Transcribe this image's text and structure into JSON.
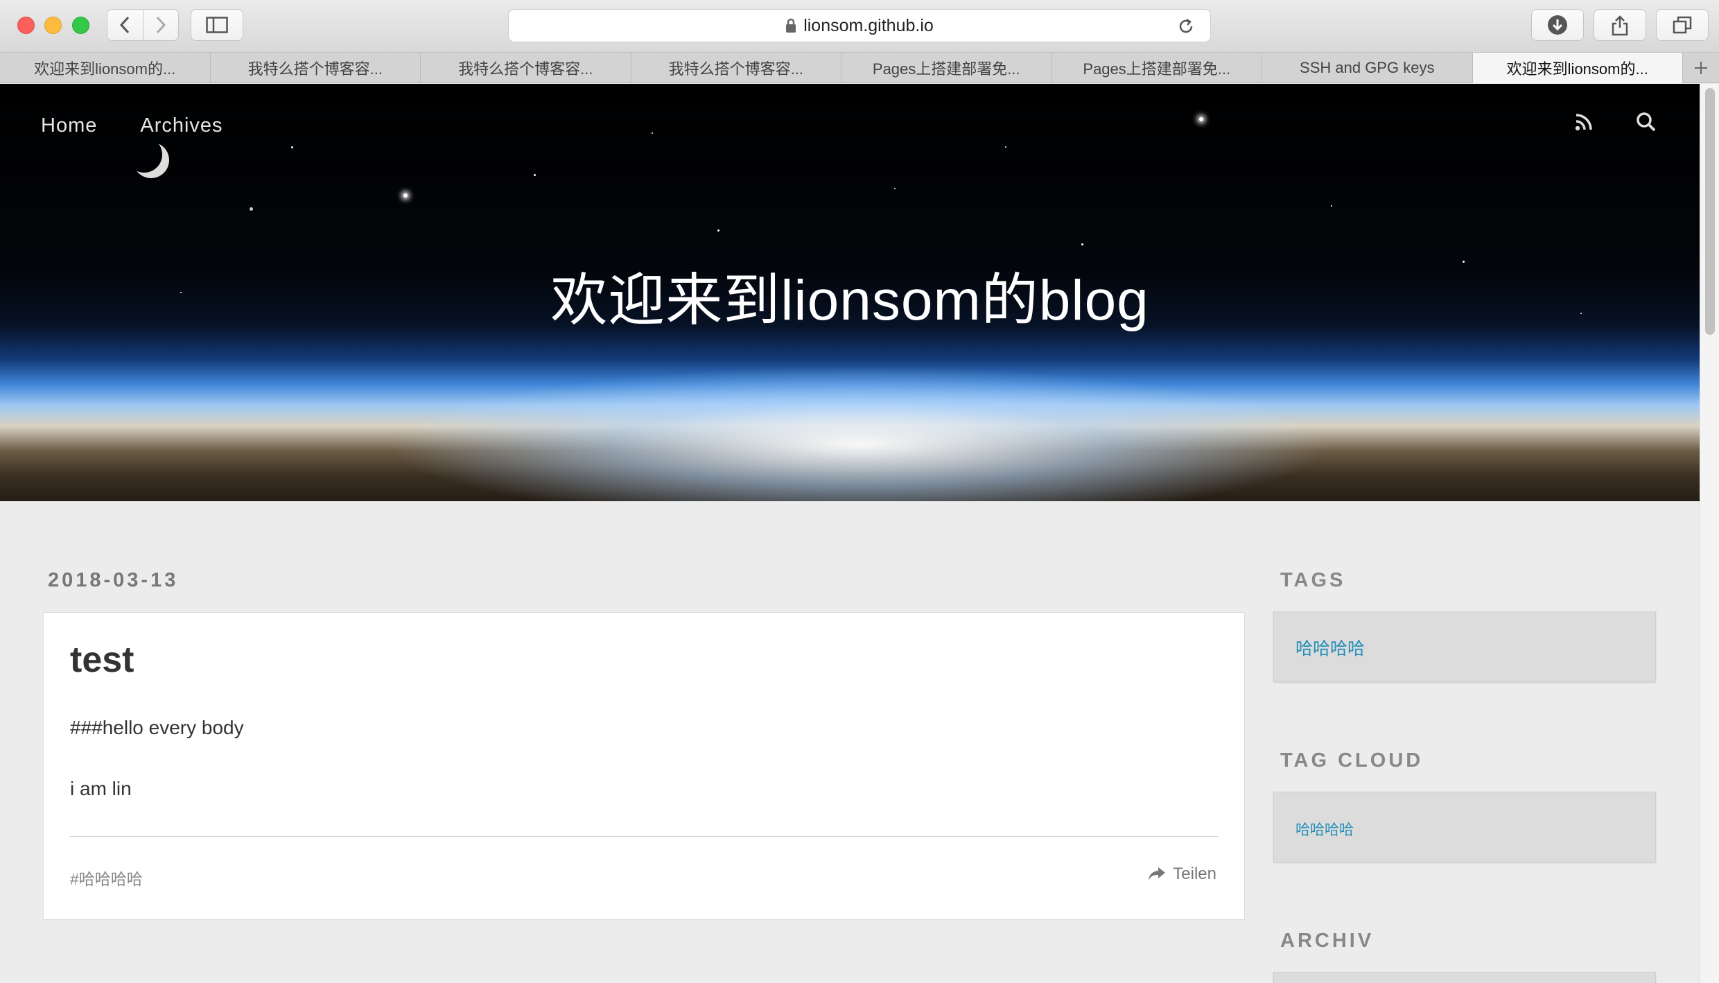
{
  "browser": {
    "url": "lionsom.github.io",
    "tabs": [
      {
        "label": "欢迎来到lionsom的..."
      },
      {
        "label": "我特么搭个博客容..."
      },
      {
        "label": "我特么搭个博客容..."
      },
      {
        "label": "我特么搭个博客容..."
      },
      {
        "label": "Pages上搭建部署免..."
      },
      {
        "label": "Pages上搭建部署免..."
      },
      {
        "label": "SSH and GPG keys"
      },
      {
        "label": "欢迎来到lionsom的..."
      }
    ],
    "active_tab": 7
  },
  "nav": {
    "home": "Home",
    "archives": "Archives"
  },
  "hero": {
    "title": "欢迎来到lionsom的blog"
  },
  "post": {
    "date": "2018-03-13",
    "title": "test",
    "paragraph1": "###hello every body",
    "paragraph2": "i am lin",
    "tag": "#哈哈哈哈",
    "share_label": "Teilen"
  },
  "sidebar": {
    "tags_title": "TAGS",
    "tags": [
      "哈哈哈哈"
    ],
    "tag_cloud_title": "TAG CLOUD",
    "tag_cloud": [
      "哈哈哈哈"
    ],
    "archive_title": "ARCHIV"
  },
  "icons": {
    "rss": "rss-icon",
    "search": "search-icon",
    "share": "share-arrow-icon"
  },
  "colors": {
    "link": "#258fb8",
    "accent_red": "#fc605c",
    "accent_yellow": "#fdbc40",
    "accent_green": "#34c84a"
  }
}
